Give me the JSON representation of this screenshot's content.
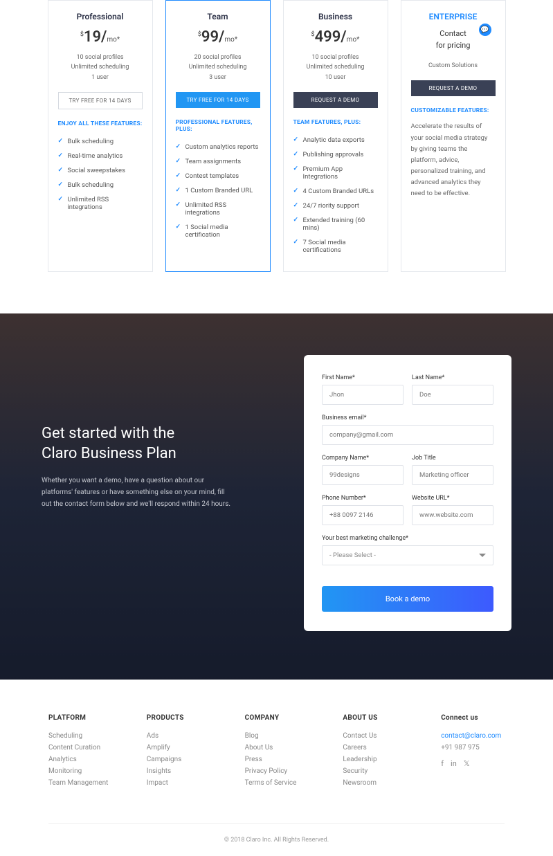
{
  "pricing": [
    {
      "name": "Professional",
      "price": "19",
      "currency": "$",
      "period": "mo*",
      "meta": [
        "10 social profiles",
        "Unlimited scheduling",
        "1 user"
      ],
      "button": "TRY FREE FOR 14 DAYS",
      "btnStyle": "outline",
      "featTitle": "ENJOY ALL THESE FEATURES:",
      "features": [
        "Bulk scheduling",
        "Real-time analytics",
        "Social sweepstakes",
        "Bulk scheduling",
        "Unlimited RSS integrations"
      ]
    },
    {
      "name": "Team",
      "price": "99",
      "currency": "$",
      "period": "mo*",
      "meta": [
        "20 social profiles",
        "Unlimited scheduling",
        "3 user"
      ],
      "button": "TRY FREE FOR 14 DAYS",
      "btnStyle": "blue",
      "featTitle": "PROFESSIONAL FEATURES, PLUS:",
      "features": [
        "Custom analytics reports",
        "Team assignments",
        "Contest templates",
        "1 Custom Branded URL",
        "Unlimited RSS integrations",
        "1 Social media certification"
      ],
      "highlight": true
    },
    {
      "name": "Business",
      "price": "499",
      "currency": "$",
      "period": "mo*",
      "meta": [
        "10 social profiles",
        "Unlimited scheduling",
        "10 user"
      ],
      "button": "REQUEST A DEMO",
      "btnStyle": "dark",
      "featTitle": "TEAM FEATURES, PLUS:",
      "features": [
        "Analytic data exports",
        "Publishing approvals",
        "Premium App Integrations",
        "4 Custom Branded URLs",
        "24/7 riority support",
        "Extended training (60 mins)",
        "7 Social media certifications"
      ]
    },
    {
      "name": "ENTERPRISE",
      "contactLine1": "Contact",
      "contactLine2": "for pricing",
      "meta": [
        "Custom Solutions"
      ],
      "button": "REQUEST A DEMO",
      "btnStyle": "dark",
      "featTitle": "CUSTOMIZABLE FEATURES:",
      "desc": "Accelerate the results of your social media strategy by giving teams the platform, advice, personalized training, and advanced analytics they need to be effective.",
      "enterprise": true
    }
  ],
  "hero": {
    "title1": "Get started with the",
    "title2": "Claro Business Plan",
    "desc": "Whether you want a demo, have a question about our platforms' features or have something else on your mind, fill out the contact form below and we'll respond within 24 hours."
  },
  "form": {
    "firstName": {
      "label": "First Name*",
      "ph": "Jhon"
    },
    "lastName": {
      "label": "Last Name*",
      "ph": "Doe"
    },
    "email": {
      "label": "Business email*",
      "ph": "company@gmail.com"
    },
    "company": {
      "label": "Company Name*",
      "ph": "99designs"
    },
    "jobTitle": {
      "label": "Job Title",
      "ph": "Marketing officer"
    },
    "phone": {
      "label": "Phone Number*",
      "ph": "+88 0097 2146"
    },
    "website": {
      "label": "Website URL*",
      "ph": "www.website.com"
    },
    "challenge": {
      "label": "Your best marketing challenge*",
      "ph": "- Please Select -"
    },
    "submit": "Book a demo"
  },
  "footer": {
    "cols": [
      {
        "title": "PLATFORM",
        "items": [
          "Scheduling",
          "Content Curation",
          "Analytics",
          "Monitoring",
          "Team Management"
        ]
      },
      {
        "title": "PRODUCTS",
        "items": [
          "Ads",
          "Amplify",
          "Campaigns",
          "Insights",
          "Impact"
        ]
      },
      {
        "title": "COMPANY",
        "items": [
          "Blog",
          "About Us",
          "Press",
          "Privacy Policy",
          "Terms of Service"
        ]
      },
      {
        "title": "ABOUT US",
        "items": [
          "Contact Us",
          "Careers",
          "Leadership",
          "Security",
          "Newsroom"
        ]
      }
    ],
    "connect": {
      "title": "Connect us",
      "email": "contact@claro.com",
      "phone": "+91 987 975"
    },
    "copy": "© 2018 Claro Inc. All Rights Reserved."
  }
}
